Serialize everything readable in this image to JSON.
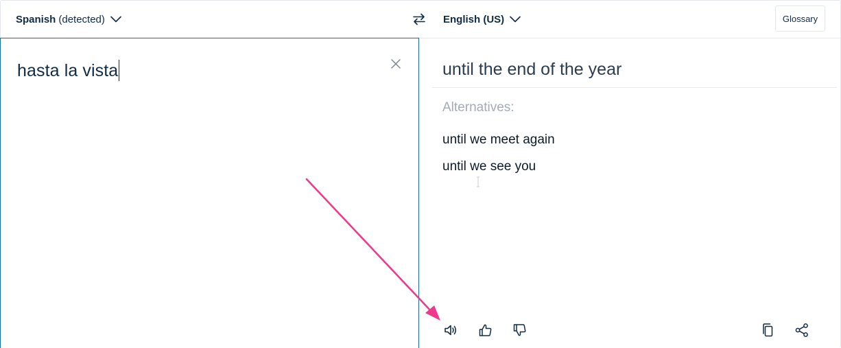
{
  "header": {
    "source_language": "Spanish",
    "source_detected": "(detected)",
    "target_language": "English (US)",
    "glossary_label": "Glossary"
  },
  "source": {
    "text": "hasta la vista"
  },
  "target": {
    "translation": "until the end of the year",
    "alternatives_label": "Alternatives:",
    "alternatives": [
      "until we meet again",
      "until we see you"
    ]
  },
  "icons": {
    "chevron": "chevron-down-icon",
    "swap": "swap-arrows-icon",
    "clear": "close-icon",
    "speaker": "speaker-icon",
    "thumbs_up": "thumbs-up-icon",
    "thumbs_down": "thumbs-down-icon",
    "copy": "copy-icon",
    "share": "share-icon"
  },
  "colors": {
    "text": "#0f2b46",
    "panel_border": "#1d6d8f",
    "annotation_arrow": "#ee3a8c",
    "alternatives_label": "#a3acb6"
  }
}
